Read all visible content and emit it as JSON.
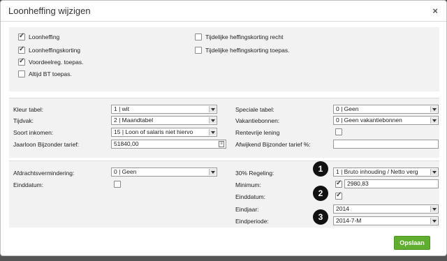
{
  "dialog": {
    "title": "Loonheffing wijzigen",
    "close_glyph": "×",
    "save_label": "Opslaan"
  },
  "section1": {
    "loonheffing": {
      "label": "Loonheffing",
      "checked": true
    },
    "loonheffingskorting": {
      "label": "Loonheffingskorting",
      "checked": true
    },
    "voordeelreg": {
      "label": "Voordeelreg. toepas.",
      "checked": true
    },
    "altijd_bt": {
      "label": "Altijd BT toepas.",
      "checked": false
    },
    "tijd_recht": {
      "label": "Tijdelijke heffingskorting recht",
      "checked": false
    },
    "tijd_toepas": {
      "label": "Tijdelijke heffingskorting toepas.",
      "checked": false
    }
  },
  "section2": {
    "kleur_tabel": {
      "label": "Kleur tabel:",
      "value": "1 | wit"
    },
    "tijdvak": {
      "label": "Tijdvak:",
      "value": "2 | Maandtabel"
    },
    "soort_inkomen": {
      "label": "Soort inkomen:",
      "value": "15 | Loon of salaris niet hiervo"
    },
    "jaarloon": {
      "label": "Jaarloon Bijzonder tarief:",
      "value": "51840,00"
    },
    "speciale_tabel": {
      "label": "Speciale tabel:",
      "value": "0 | Geen"
    },
    "vakantiebonnen": {
      "label": "Vakantiebonnen:",
      "value": "0 | Geen vakantiebonnen"
    },
    "rentevrije": {
      "label": "Rentevrije lening",
      "checked": false
    },
    "afwijkend": {
      "label": "Afwijkend Bijzonder tarief %:",
      "value": ""
    }
  },
  "section3": {
    "afdracht": {
      "label": "Afdrachtsvermindering:",
      "value": "0 | Geen"
    },
    "einddatum_left": {
      "label": "Einddatum:",
      "checked": false
    },
    "regeling30": {
      "label": "30% Regeling:",
      "value": "1 | Bruto inhouding / Netto verg"
    },
    "minimum": {
      "label": "Minimum:",
      "checked": true,
      "value": "2980,83"
    },
    "einddatum_right": {
      "label": "Einddatum:",
      "checked": true
    },
    "eindjaar": {
      "label": "Eindjaar:",
      "value": "2014"
    },
    "eindperiode": {
      "label": "Eindperiode:",
      "value": "2014-7-M"
    }
  },
  "callouts": [
    "1",
    "2",
    "3"
  ],
  "colors": {
    "save_button": "#5fae2e",
    "panel": "#f2f2f2",
    "callout": "#111111"
  },
  "icons": {
    "calculator": "calculator-icon",
    "dropdown": "chevron-down-icon",
    "close": "close-icon"
  }
}
